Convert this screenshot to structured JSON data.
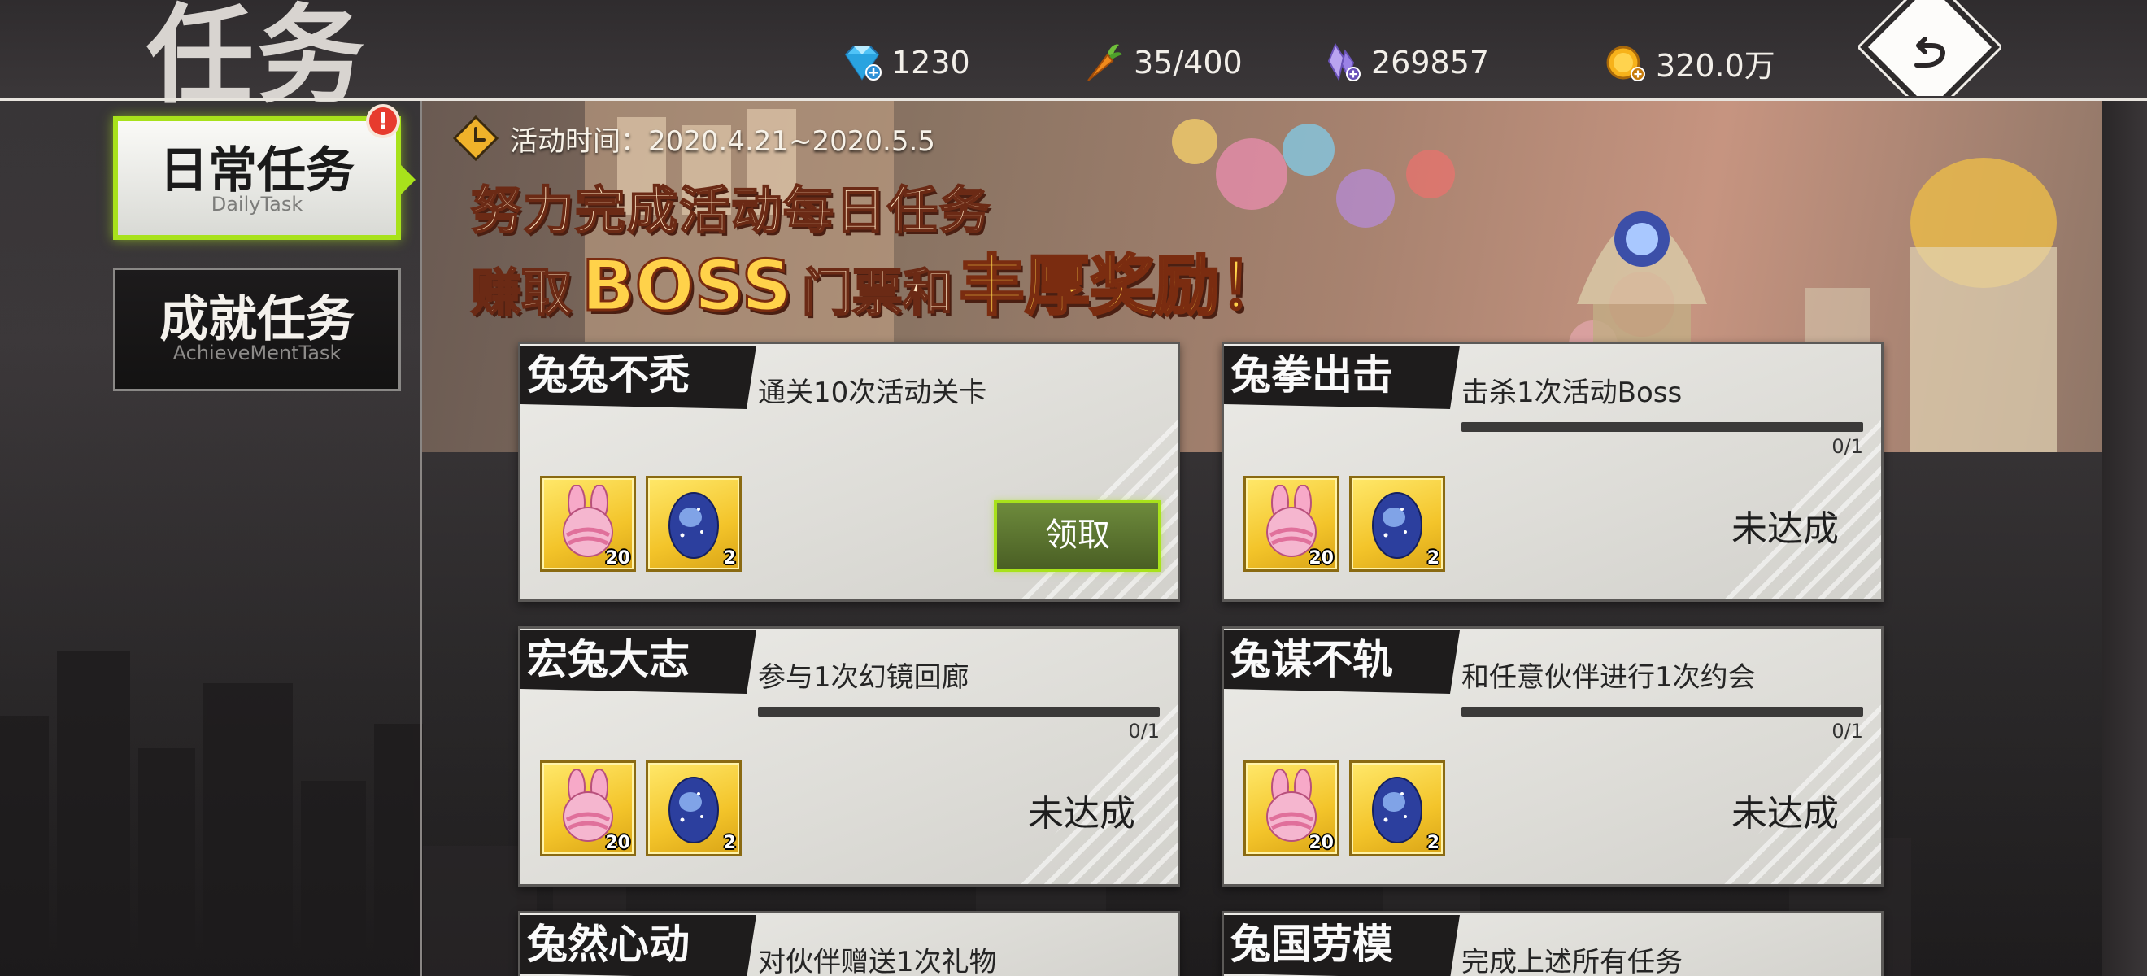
{
  "header": {
    "title": "任务",
    "resources": [
      {
        "icon": "diamond-icon",
        "value": "1230"
      },
      {
        "icon": "carrot-icon",
        "value": "35/400"
      },
      {
        "icon": "crystal-icon",
        "value": "269857"
      },
      {
        "icon": "gold-coin-icon",
        "value": "320.0万"
      }
    ],
    "back_icon": "back-arrow-icon"
  },
  "tabs": [
    {
      "label": "日常任务",
      "sublabel": "DailyTask",
      "active": true,
      "alert": "!"
    },
    {
      "label": "成就任务",
      "sublabel": "AchieveMentTask",
      "active": false
    }
  ],
  "banner": {
    "time_label": "活动时间：2020.4.21~2020.5.5",
    "line1": "努力完成活动每日任务",
    "line2_prefix": "赚取",
    "line2_boss": "BOSS",
    "line2_mid": "门票和",
    "line2_big": "丰厚奖励！"
  },
  "tasks": [
    {
      "name": "兔兔不秃",
      "desc": "通关10次活动关卡",
      "progress": null,
      "progress_text": "",
      "rewards": [
        {
          "icon": "rabbit-candy-icon",
          "count": "20"
        },
        {
          "icon": "star-egg-icon",
          "count": "2"
        }
      ],
      "action": "领取",
      "status": ""
    },
    {
      "name": "兔拳出击",
      "desc": "击杀1次活动Boss",
      "progress": 0,
      "progress_text": "0/1",
      "rewards": [
        {
          "icon": "rabbit-candy-icon",
          "count": "20"
        },
        {
          "icon": "star-egg-icon",
          "count": "2"
        }
      ],
      "action": "",
      "status": "未达成"
    },
    {
      "name": "宏兔大志",
      "desc": "参与1次幻镜回廊",
      "progress": 0,
      "progress_text": "0/1",
      "rewards": [
        {
          "icon": "rabbit-candy-icon",
          "count": "20"
        },
        {
          "icon": "star-egg-icon",
          "count": "2"
        }
      ],
      "action": "",
      "status": "未达成"
    },
    {
      "name": "兔谋不轨",
      "desc": "和任意伙伴进行1次约会",
      "progress": 0,
      "progress_text": "0/1",
      "rewards": [
        {
          "icon": "rabbit-candy-icon",
          "count": "20"
        },
        {
          "icon": "star-egg-icon",
          "count": "2"
        }
      ],
      "action": "",
      "status": "未达成"
    },
    {
      "name": "兔然心动",
      "desc": "对伙伴赠送1次礼物"
    },
    {
      "name": "兔国劳模",
      "desc": "完成上述所有任务"
    }
  ],
  "colors": {
    "accent": "#a8e21b",
    "alert": "#e73b2e",
    "reward_bg": "#f3c42a"
  }
}
